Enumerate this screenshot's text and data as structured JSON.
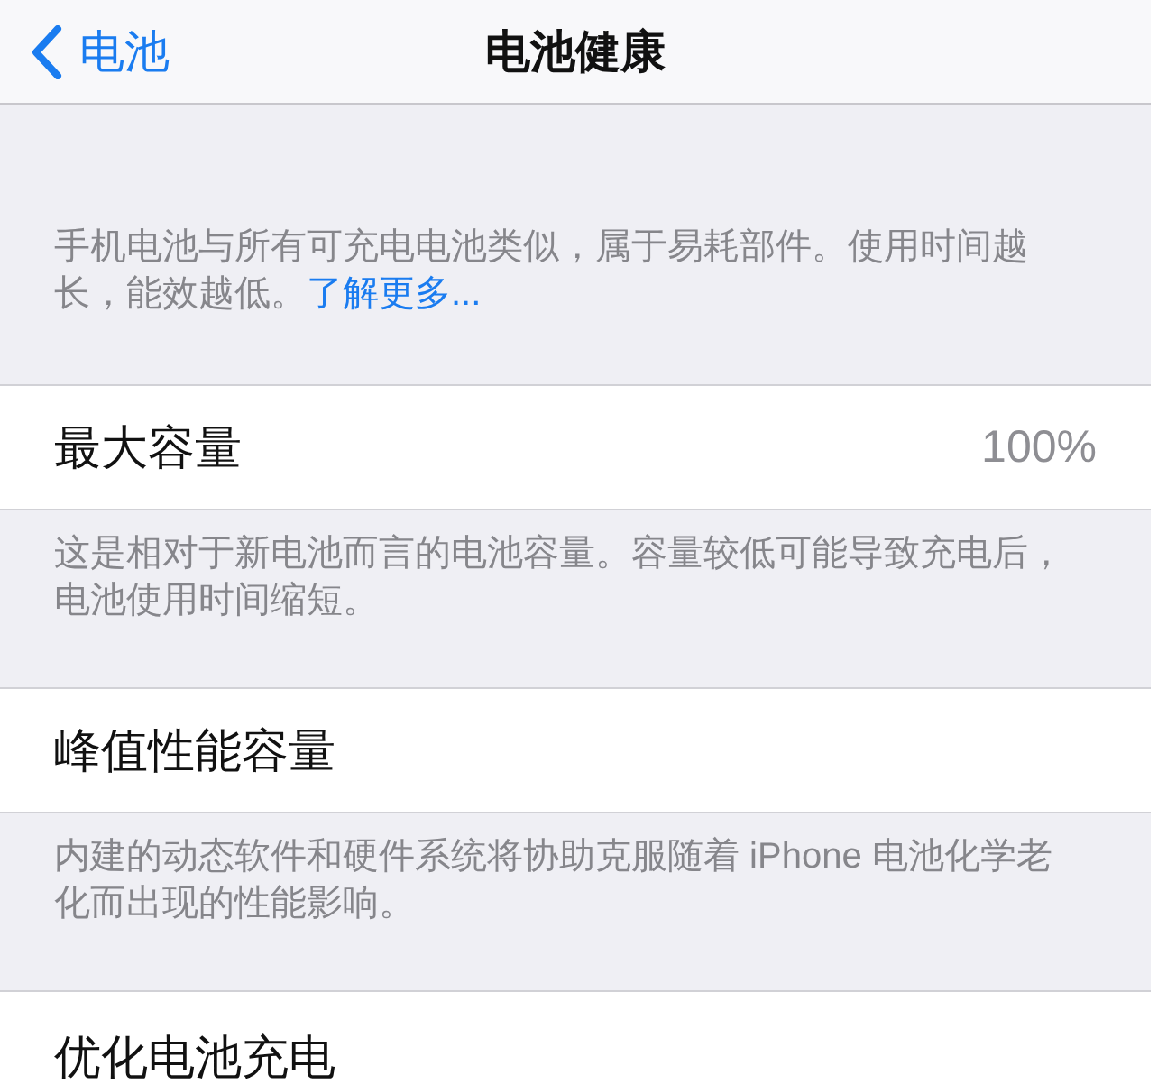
{
  "nav_bar": {
    "back": {
      "label": "电池"
    },
    "title": "电池健康"
  },
  "sections": [
    {
      "kind": "note",
      "text": "手机电池与所有可充电电池类似，属于易耗部件。使用时间越长，能效越低。",
      "link": "了解更多..."
    },
    {
      "kind": "row",
      "label": "最大容量",
      "value": "100%"
    },
    {
      "kind": "note",
      "text": "这是相对于新电池而言的电池容量。容量较低可能导致充电后，电池使用时间缩短。"
    },
    {
      "kind": "row",
      "label": "峰值性能容量"
    },
    {
      "kind": "note",
      "text": "内建的动态软件和硬件系统将协助克服随着 iPhone 电池化学老化而出现的性能影响。"
    },
    {
      "kind": "row",
      "label": "优化电池充电"
    }
  ]
}
